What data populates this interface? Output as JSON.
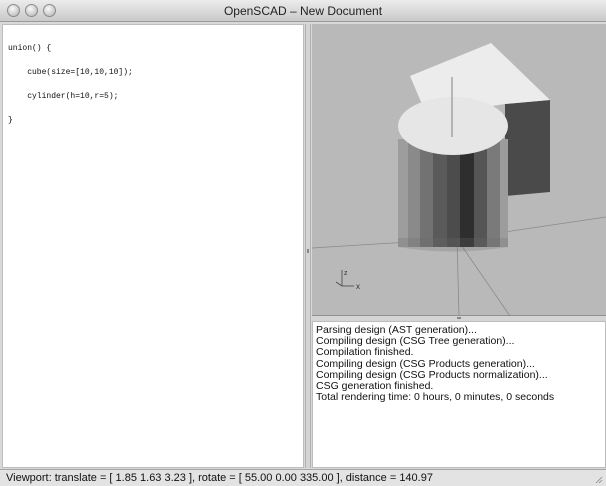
{
  "window": {
    "title": "OpenSCAD – New Document"
  },
  "editor": {
    "lines": [
      "union() {",
      "    cube(size=[10,10,10]);",
      "    cylinder(h=10,r=5);",
      "}"
    ]
  },
  "viewport": {
    "axis_labels": {
      "x": "x",
      "z": "z"
    },
    "colors": {
      "background": "#b9b9b9",
      "cube_top": "#ececec",
      "cube_side_dark": "#4d4d4d",
      "cylinder_top": "#e6e6e6"
    }
  },
  "console": {
    "lines": [
      "Parsing design (AST generation)...",
      "Compiling design (CSG Tree generation)...",
      "Compilation finished.",
      "Compiling design (CSG Products generation)...",
      "Compiling design (CSG Products normalization)...",
      "CSG generation finished.",
      "Total rendering time: 0 hours, 0 minutes, 0 seconds"
    ]
  },
  "statusbar": {
    "text": "Viewport: translate = [ 1.85 1.63 3.23 ], rotate = [ 55.00 0.00 335.00 ], distance = 140.97"
  }
}
